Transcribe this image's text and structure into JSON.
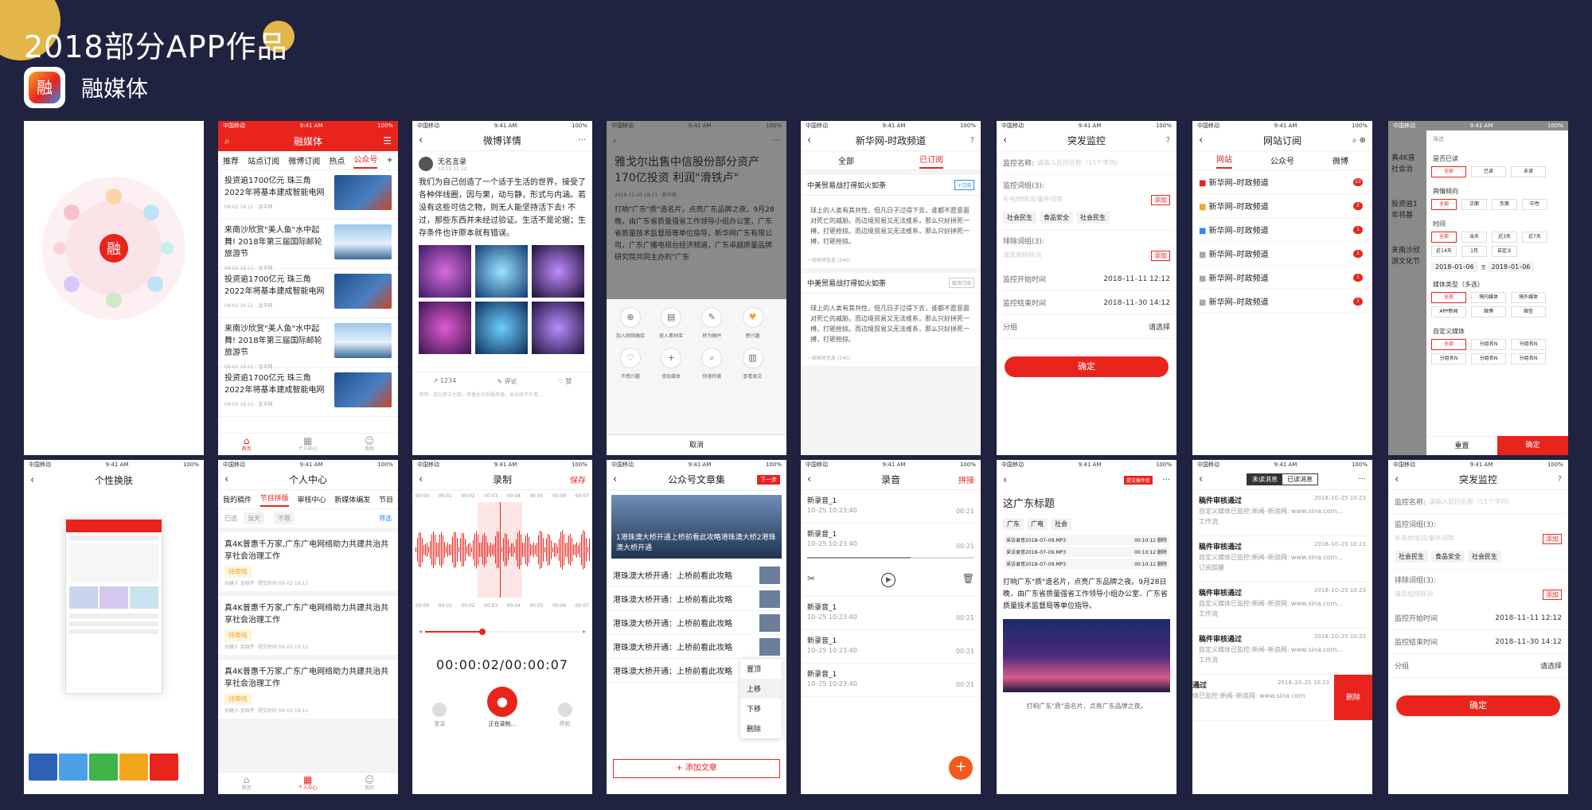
{
  "header": {
    "title": "2018部分APP作品",
    "app_name": "融媒体",
    "app_icon_char": "融"
  },
  "status": {
    "carrier": "中国移动",
    "time": "9:41 AM",
    "battery": "100%"
  },
  "screens": {
    "s2": {
      "title": "融媒体",
      "tabs": [
        "推荐",
        "站点订阅",
        "微博订阅",
        "热点",
        "公众号"
      ],
      "news": [
        {
          "title": "投资逾1700亿元 珠三角2022年将基本建成智能电网",
          "meta": "09-02 19:11 · 金羊网"
        },
        {
          "title": "来南沙欣赏\"美人鱼\"水中起舞! 2018年第三届国际邮轮旅游节",
          "meta": "09-02 19:11 · 金羊网"
        },
        {
          "title": "投资逾1700亿元 珠三角2022年将基本建成智能电网",
          "meta": "09-02 19:11 · 金羊网"
        },
        {
          "title": "来南沙欣赏\"美人鱼\"水中起舞! 2018年第三届国际邮轮旅游节",
          "meta": "09-02 19:11 · 金羊网"
        },
        {
          "title": "投资逾1700亿元 珠三角2022年将基本建成智能电网",
          "meta": "09-02 19:11 · 金羊网"
        }
      ],
      "tabbar": [
        "首页",
        "个人中心",
        "我的"
      ]
    },
    "s3": {
      "title": "微博详情",
      "author": "无名言录",
      "date": "10-10 12:12",
      "body": "我们为自己创造了一个适于生活的世界，接受了各种伴线圈，因与果，动与静，形式与内涵。若没有这些可信之物，则无人能坚持活下去! 不过，那些东西并未经过验证。生活不是论据；生存条件也许原本就有错误。",
      "stats": [
        "1234",
        "评论",
        "赞"
      ],
      "note": "声明：该以原文为准，传播此示例服务器，本站转不负责。"
    },
    "s4": {
      "headline": "雅戈尔出售中信股份部分资产 170亿投资 利润\"滑铁卢\"",
      "meta": "2018-11-20 18:11 · 新华网",
      "body": "打响\"广东\"质\"造名片，点亮广东品牌之夜。9月28晚，由广东省质量强省工作领导小组办公室，广东省质量技术监督局等单位指导，新华网广东有限公司，广东广播电视台经济频道，广东卓越质量品牌研究院共同主办的\"广东",
      "actions": [
        "加入网络稿库",
        "放入素材库",
        "转为稿件",
        "感兴趣",
        "不感兴趣",
        "添加媒体",
        "快速检索",
        "查看原文"
      ],
      "cancel": "取消"
    },
    "s5": {
      "title": "新华网-时政频道",
      "tabs": [
        "全部",
        "已订阅"
      ],
      "cards": [
        {
          "head": "中美贸易战打得如火如荼",
          "btn": "+订阅",
          "body": "球上的人类有其共性，但凡日子过得下去，谁都不愿意面对死亡的威胁。而边境贸易又无法维系，那么只好拼死一搏，打砸抢掠。而边境贸易又无法维系，那么只好拼死一搏，打砸抢掠。",
          "meta": "一周相关信息 (240)"
        },
        {
          "head": "中美贸易战打得如火如荼",
          "btn": "取消订阅",
          "body": "球上的人类有其共性，但凡日子过得下去，谁都不愿意面对死亡的威胁。而边境贸易又无法维系，那么只好拼死一搏，打砸抢掠。而边境贸易又无法维系，那么只好拼死一搏，打砸抢掠。",
          "meta": "一周相关信息 (240)"
        }
      ]
    },
    "s6": {
      "title": "突发监控",
      "name_label": "监控名称:",
      "name_ph": "请输入监控名称（15个字内）",
      "kw_label": "监控词组(3):",
      "kw_ph": "补充地域词/事件词等",
      "add": "添加",
      "chips": [
        "社会民生",
        "食品安全",
        "社会民生"
      ],
      "ex_label": "排除词组(3):",
      "ex_ph": "请添加排除词",
      "start_label": "监控开始时间",
      "start": "2018–11–11 12:12",
      "end_label": "监控结束时间",
      "end": "2018–11–30 14:12",
      "group_label": "分组",
      "group": "请选择",
      "ok": "确定"
    },
    "s7": {
      "title": "网站订阅",
      "tabs": [
        "网站",
        "公众号",
        "微博"
      ],
      "rows": [
        "新华网–时政频道",
        "新华网–时政频道",
        "新华网–时政频道",
        "新华网–时政频道",
        "新华网–时政频道",
        "新华网–时政频道"
      ],
      "badges": [
        "22",
        "2",
        "1",
        "1",
        "1",
        "1"
      ]
    },
    "s8": {
      "filter": "筛选",
      "sec1": "是否已读",
      "o1": [
        "全部",
        "已读",
        "未读"
      ],
      "sec2": "舆情倾向",
      "o2": [
        "全部",
        "正面",
        "负面",
        "中性"
      ],
      "sec3": "时间",
      "o3": [
        "全部",
        "当天",
        "近3天",
        "近7天",
        "近14天",
        "1月",
        "自定义"
      ],
      "range": [
        "2018–01–06",
        "至",
        "2018–01–06"
      ],
      "sec4": "媒体类型（多选）",
      "o4": [
        "全部",
        "境内媒体",
        "境外媒体",
        "APP新闻",
        "微博",
        "微信"
      ],
      "sec5": "自定义媒体",
      "o5": [
        "全部",
        "分组名N",
        "分组名N",
        "分组名N",
        "分组名N",
        "分组名N"
      ],
      "reset": "重置",
      "ok": "确定",
      "left": [
        "真4K普",
        "社会治",
        "投资逾1",
        "年将基",
        "来南沙欣",
        "游文化节"
      ]
    },
    "s9": {
      "title": "个性换肤"
    },
    "s10": {
      "title": "个人中心",
      "tabs": [
        "我的稿件",
        "节目拼版",
        "审核中心",
        "新媒体编发",
        "节目"
      ],
      "filters": [
        "已选",
        "当天",
        "不限",
        "筛选"
      ],
      "items": [
        {
          "t": "真4K普惠千万家,广东广电网络助力共建共治共享社会治理工作",
          "tag": "待审核",
          "who": "创建人 金晓平",
          "time": "提交时间 09–02 19:11"
        },
        {
          "t": "真4K普惠千万家,广东广电网络助力共建共治共享社会治理工作",
          "tag": "待审核",
          "who": "创建人 金晓平",
          "time": "提交时间 09–02 19:11"
        },
        {
          "t": "真4K普惠千万家,广东广电网络助力共建共治共享社会治理工作",
          "tag": "待审核",
          "who": "创建人 金晓平",
          "time": "提交时间 09–02 19:11"
        }
      ],
      "tabbar": [
        "首页",
        "个人中心",
        "我的"
      ]
    },
    "s11": {
      "title": "录制",
      "save": "保存",
      "ticks": [
        "00:00",
        "00:01",
        "00:02",
        "00:03",
        "00:04",
        "00:05",
        "00:06",
        "00:07"
      ],
      "time": "00:00:02/00:00:07",
      "btns": [
        "重录",
        "正在录制...",
        "停剪"
      ]
    },
    "s12": {
      "title": "公众号文章集",
      "next": "下一步",
      "hero": "1港珠澳大桥开通上桥前看此攻略港珠澳大桥2港珠澳大桥开通",
      "items": [
        "港珠澳大桥开通：上桥前看此攻略",
        "港珠澳大桥开通：上桥前看此攻略",
        "港珠澳大桥开通：上桥前看此攻略",
        "港珠澳大桥开通：上桥前看此攻略",
        "港珠澳大桥开通：上桥前看此攻略"
      ],
      "menu": [
        "置顶",
        "上移",
        "下移",
        "删除"
      ],
      "add": "+ 添加文章"
    },
    "s13": {
      "title": "录音",
      "join": "拼接",
      "recs": [
        {
          "n": "新录音_1",
          "d": "10–25 10:23:40",
          "t": "00:21"
        },
        {
          "n": "新录音_1",
          "d": "10–25 10:23:40",
          "t": "00:21"
        },
        {
          "n": "新录音_1",
          "d": "10–25 10:23:40",
          "t": "00:21"
        },
        {
          "n": "新录音_1",
          "d": "10–25 10:23:40",
          "t": "00:21"
        },
        {
          "n": "新录音_1",
          "d": "10–25 10:23:40",
          "t": "00:21"
        }
      ],
      "add": "+"
    },
    "s14": {
      "btn": "提交稿件库",
      "title": "这广东标题",
      "tags": [
        "广东",
        "广电",
        "社会"
      ],
      "audios": [
        "采访录音2018–07–09.MP3",
        "采访录音2018–07–09.MP3",
        "采访录音2018–07–09.MP3"
      ],
      "dur": "00:10:12",
      "del": "删除",
      "body": "打响广东\"质\"造名片，点亮广东品牌之夜。9月28日晚，由广东省质量强省工作领导小组办公室、广东省质量技术监督局等单位指导。",
      "caption": "打响广东\"质\"造名片，点亮广东品牌之夜。"
    },
    "s15": {
      "tabs": [
        "未读消息",
        "已读消息"
      ],
      "items": [
        {
          "t": "稿件审核通过",
          "d": "2018–10–25 10:23",
          "s": "自定义媒体已监控:新闻–新浪网: www.sina.com...",
          "tag": "工作流"
        },
        {
          "t": "稿件审核通过",
          "d": "2018–10–25 10:23",
          "s": "自定义媒体已监控:新闻–新浪网: www.sina.com...",
          "tag": "订阅提醒"
        },
        {
          "t": "稿件审核通过",
          "d": "2018–10–25 10:23",
          "s": "自定义媒体已监控:新闻–新浪网: www.sina.com...",
          "tag": "工作流"
        },
        {
          "t": "稿件审核通过",
          "d": "2018–10–25 10:23",
          "s": "自定义媒体已监控:新闻–新浪网: www.sina.com...",
          "tag": "工作流"
        }
      ],
      "swipe": {
        "t": "通过",
        "d": "2018–10–25 10:23",
        "s": "体已监控:新闻–新浪网: www.sina.com",
        "del": "删除"
      }
    },
    "s16": {
      "title": "突发监控",
      "name_label": "监控名称:",
      "name_ph": "请输入监控名称（15个字内）",
      "kw_label": "监控词组(3):",
      "kw_ph": "补充地域词/事件词等",
      "add": "添加",
      "chips": [
        "社会民生",
        "食品安全",
        "社会民生"
      ],
      "ex_label": "排除词组(3):",
      "ex_ph": "请添加排除词",
      "start_label": "监控开始时间",
      "start": "2018–11–11 12:12",
      "end_label": "监控结束时间",
      "end": "2018–11–30 14:12",
      "group_label": "分组",
      "group": "请选择",
      "ok": "确定"
    }
  },
  "colors": {
    "bg": "#1f2340",
    "accent": "#e8241d",
    "gold": "#e4b64a"
  },
  "skins": [
    "#2e62b8",
    "#4ea0e6",
    "#3fb448",
    "#f2a71b",
    "#e8241d"
  ]
}
